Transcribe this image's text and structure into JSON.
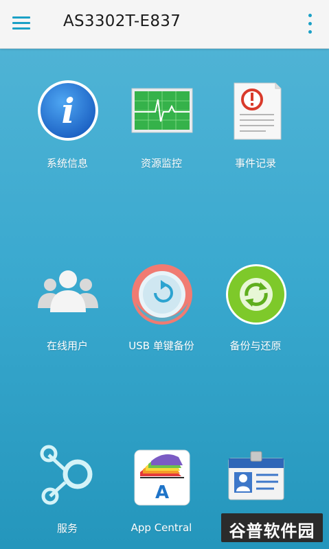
{
  "header": {
    "title": "AS3302T-E837",
    "menu_icon": "hamburger-menu-icon",
    "more_icon": "more-vertical-icon"
  },
  "tiles": [
    {
      "label": "系统信息",
      "icon": "info-icon"
    },
    {
      "label": "资源监控",
      "icon": "monitor-icon"
    },
    {
      "label": "事件记录",
      "icon": "event-log-icon"
    },
    {
      "label": "在线用户",
      "icon": "users-icon"
    },
    {
      "label": "USB 单键备份",
      "icon": "usb-backup-icon"
    },
    {
      "label": "备份与还原",
      "icon": "backup-restore-icon"
    },
    {
      "label": "服务",
      "icon": "services-icon"
    },
    {
      "label": "App Central",
      "icon": "app-central-icon"
    },
    {
      "label": "",
      "icon": "id-card-icon"
    }
  ],
  "watermark": {
    "text_accent": "谷普",
    "text_rest": "软件园"
  },
  "colors": {
    "accent": "#1aa0c6",
    "background_top": "#4fb3d5",
    "background_bottom": "#2496bc"
  }
}
